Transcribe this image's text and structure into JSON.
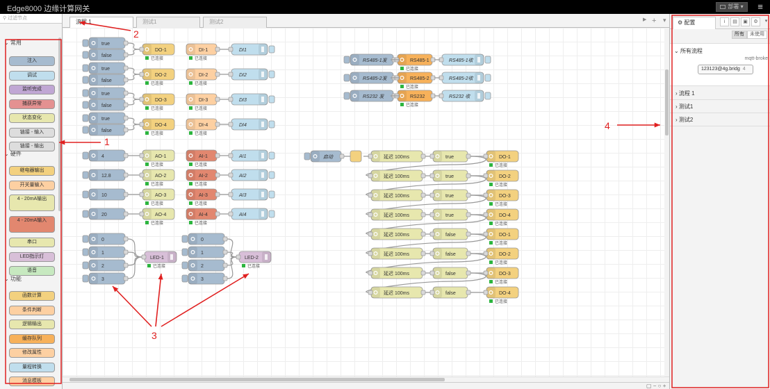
{
  "app": {
    "title": "Edge8000 边缘计算网关",
    "deploy_label": "部署",
    "menu_icon": "hamburger-icon"
  },
  "palette": {
    "search_placeholder": "过滤节点",
    "categories": [
      "常用",
      "硬件",
      "功能"
    ],
    "common": [
      "注入",
      "调试",
      "监听完成",
      "捕获异常",
      "状态变化",
      "链接 - 输入",
      "链接 - 输出"
    ],
    "hardware": [
      "继电器输出",
      "开关量输入",
      "4 - 20mA输出",
      "4 - 20mA输入",
      "串口",
      "LED指示灯",
      "语音"
    ],
    "function": [
      "函数计算",
      "条件判断",
      "逻辑输出",
      "缓存队列",
      "修改属性",
      "量程转换",
      "消息模板",
      "延时"
    ]
  },
  "tabs": [
    "流程 1",
    "测试1",
    "测试2"
  ],
  "status": {
    "connected": "已连接"
  },
  "flow": {
    "inject_true": "true",
    "inject_false": "false",
    "do": [
      "DO-1",
      "DO-2",
      "DO-3",
      "DO-4"
    ],
    "di": [
      "DI-1",
      "DI-2",
      "DI-3",
      "DI-4"
    ],
    "di_debug": [
      "DI1",
      "DI2",
      "DI3",
      "DI4"
    ],
    "ao_inputs": [
      "4",
      "12.8",
      "10",
      "20"
    ],
    "ao": [
      "AO-1",
      "AO-2",
      "AO-3",
      "AO-4"
    ],
    "ai": [
      "AI-1",
      "AI-2",
      "AI-3",
      "AI-4"
    ],
    "ai_debug": [
      "AI1",
      "AI2",
      "AI3",
      "AI4"
    ],
    "led_inputs": [
      "0",
      "1",
      "2",
      "3"
    ],
    "led": [
      "LED-1",
      "LED-2"
    ],
    "serial": [
      {
        "in": "RS485-1发",
        "node": "RS485-1",
        "out": "RS485-1收"
      },
      {
        "in": "RS485-2发",
        "node": "RS485-2",
        "out": "RS485-2收"
      },
      {
        "in": "RS232 发",
        "node": "RS232",
        "out": "RS232 收"
      }
    ],
    "startup": "启动",
    "delay": "延迟 100ms",
    "seq_values": [
      "true",
      "true",
      "true",
      "true",
      "false",
      "false",
      "false",
      "false"
    ],
    "seq_outputs": [
      "DO-1",
      "DO-2",
      "DO-3",
      "DO-4",
      "DO-1",
      "DO-2",
      "DO-3",
      "DO-4"
    ]
  },
  "sidebar": {
    "tab": "配置",
    "icons": [
      "info-icon",
      "book-icon",
      "lock-icon",
      "gear-icon",
      "chevron-down-icon"
    ],
    "filter_all": "所有",
    "filter_unused": "未使用",
    "all_flows": "所有流程",
    "mqtt_label": "mqtt-broke",
    "broker": "123123@4g.bridg",
    "broker_count": "4",
    "flows": [
      "流程 1",
      "测试1",
      "测试2"
    ]
  },
  "annotations": [
    "1",
    "2",
    "3",
    "4"
  ],
  "colors": {
    "accent_red": "#e02020",
    "inject": "#a6bbcf",
    "debug": "#c0deed",
    "do": "#f3d17f",
    "di": "#fdd0a2",
    "ai": "#e2876f",
    "function": "#e7e7ae",
    "led": "#d8bfd8",
    "serial": "#f7b15a",
    "status_green": "#2db53f"
  }
}
